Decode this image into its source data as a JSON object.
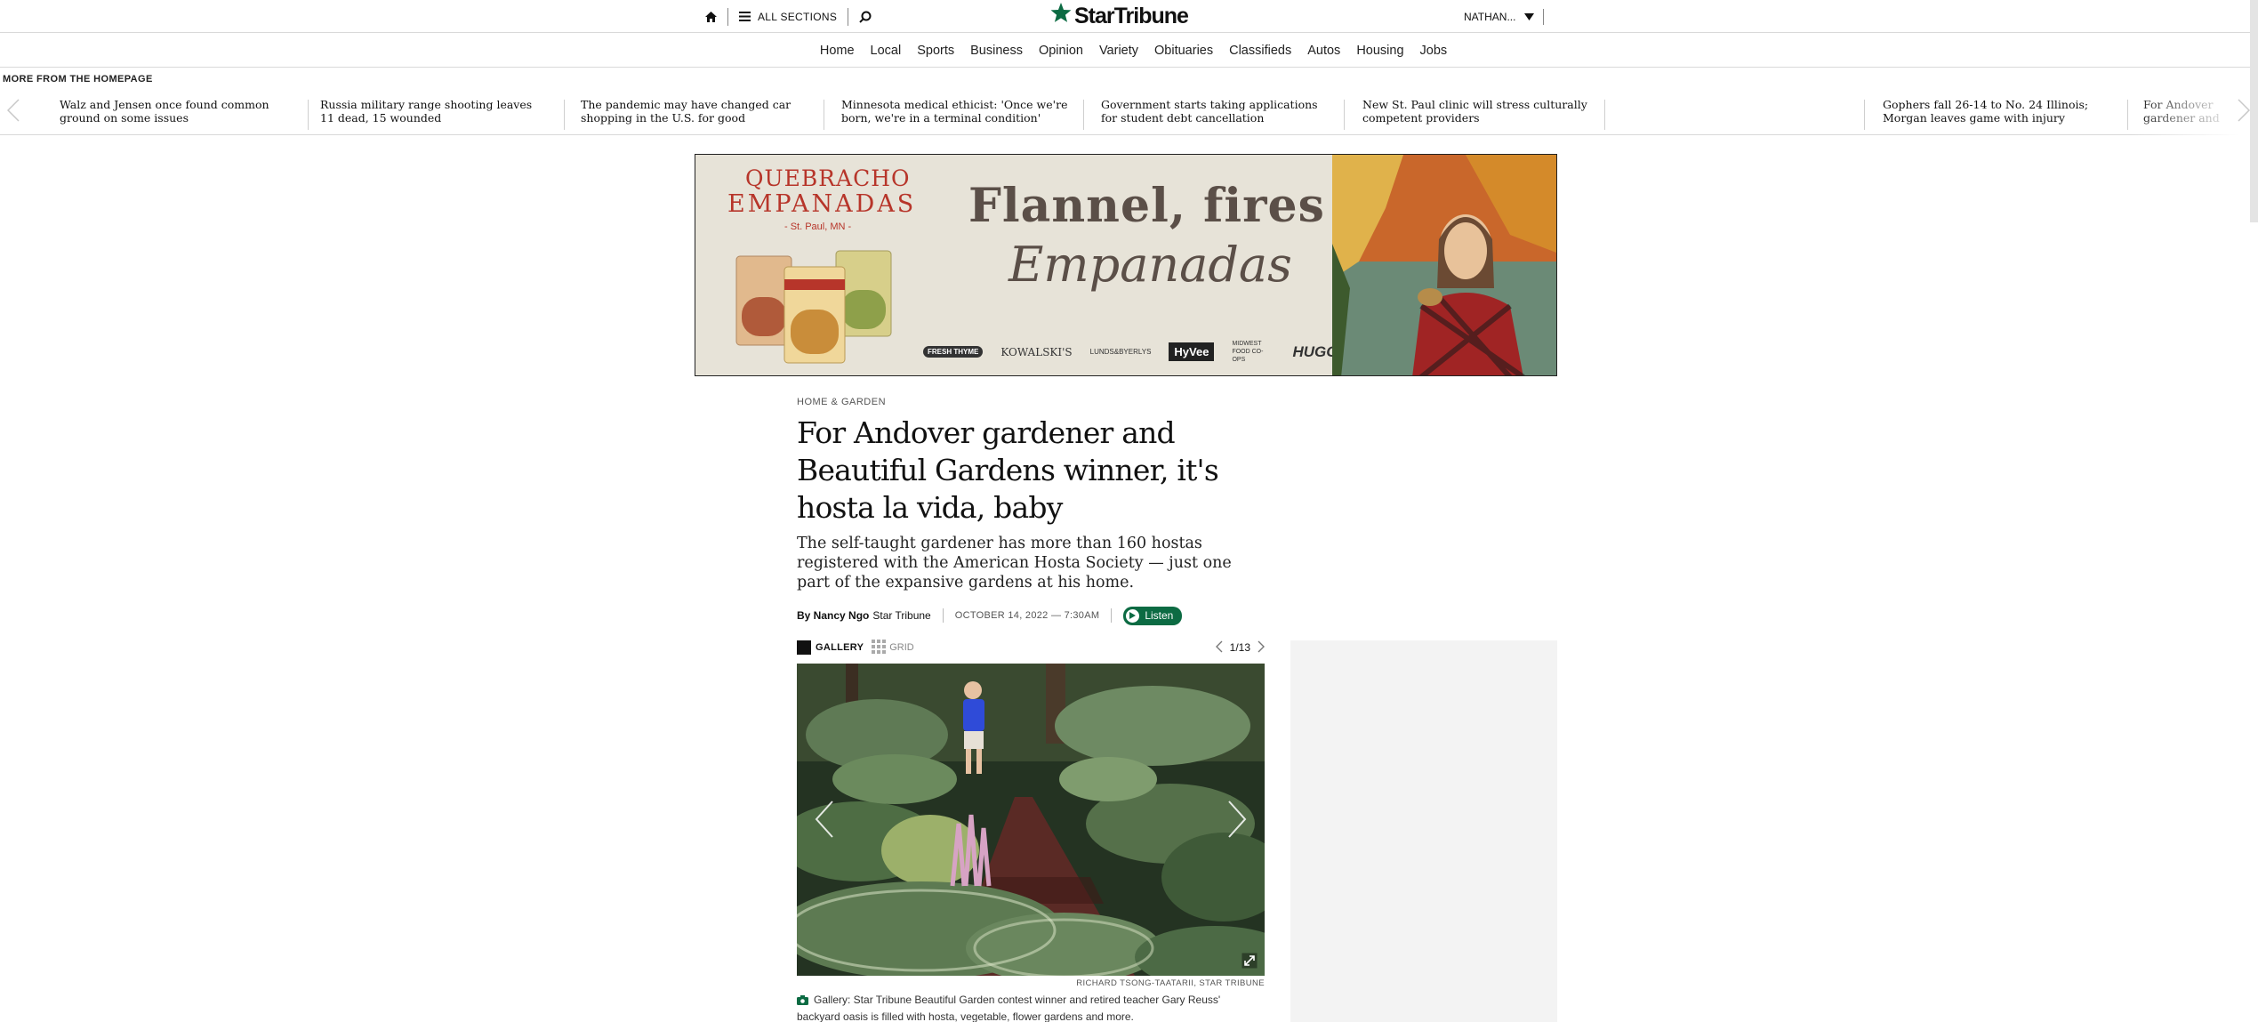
{
  "topbar": {
    "home_icon": "home-icon",
    "sections_label": "ALL SECTIONS",
    "search_icon": "search-icon",
    "logo_text": "StarTribune",
    "user_label": "NATHAN...",
    "brand_color": "#0c6b43"
  },
  "nav": {
    "items": [
      "Home",
      "Local",
      "Sports",
      "Business",
      "Opinion",
      "Variety",
      "Obituaries",
      "Classifieds",
      "Autos",
      "Housing",
      "Jobs"
    ]
  },
  "more": {
    "label": "MORE FROM THE HOMEPAGE",
    "items": [
      "Walz and Jensen once found common ground on some issues",
      "Russia military range shooting leaves 11 dead, 15 wounded",
      "The pandemic may have changed car shopping in the U.S. for good",
      "Minnesota medical ethicist: 'Once we're born, we're in a terminal condition'",
      "Government starts taking applications for student debt cancellation",
      "New St. Paul clinic will stress culturally competent providers",
      "Gophers fall 26-14 to No. 24 Illinois; Morgan leaves game with injury",
      "For Andover gardener and Beautiful Gardens winner"
    ]
  },
  "ad": {
    "brand_line1": "QUEBRACHO",
    "brand_line2": "EMPANADAS",
    "brand_line3": "- St. Paul, MN -",
    "headline1": "Flannel, fires &",
    "headline2": "Empanadas",
    "retailers": [
      "FRESH THYME",
      "KOWALSKI'S",
      "LUNDS&BYERLYS",
      "HyVee",
      "MIDWEST FOOD CO-OPS",
      "HUGO'S"
    ]
  },
  "article": {
    "kicker": "HOME & GARDEN",
    "headline": "For Andover gardener and Beautiful Gardens winner, it's hosta la vida, baby",
    "dek": "The self-taught gardener has more than 160 hostas registered with the American Hosta Society — just one part of the expansive gardens at his home.",
    "byline_prefix": "By Nancy Ngo",
    "byline_org": "Star Tribune",
    "date": "OCTOBER 14, 2022 — 7:30AM",
    "listen_label": "Listen"
  },
  "gallery": {
    "gallery_label": "GALLERY",
    "grid_label": "GRID",
    "counter": "1/13",
    "credit": "RICHARD TSONG-TAATARII, STAR TRIBUNE",
    "caption": "Gallery: Star Tribune Beautiful Garden contest winner and retired teacher Gary Reuss' backyard oasis is filled with hosta, vegetable, flower gardens and more."
  }
}
